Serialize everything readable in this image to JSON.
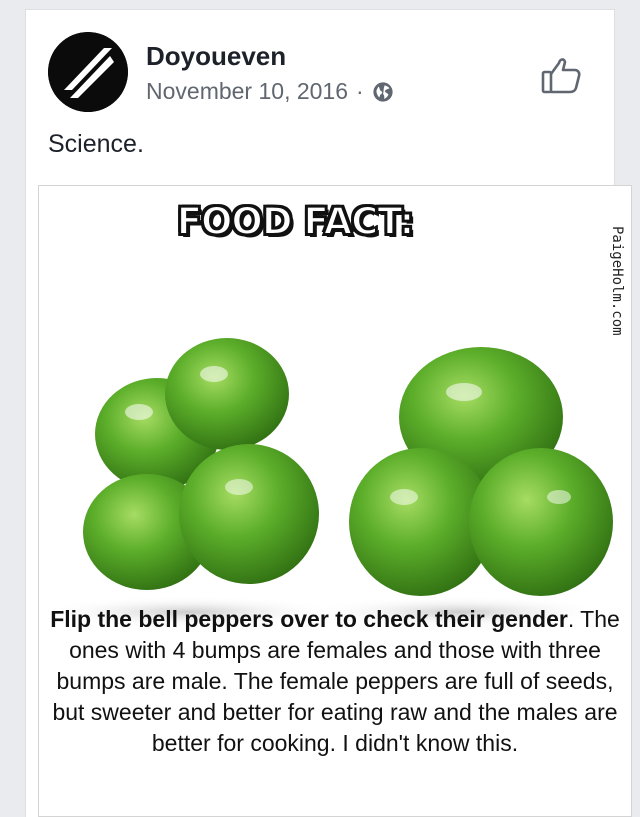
{
  "post": {
    "page_name": "Doyoueven",
    "date": "November 10, 2016",
    "separator": "·",
    "privacy_icon": "globe-icon",
    "like_icon": "thumbs-up-icon",
    "caption": "Science."
  },
  "image": {
    "headline": "FOOD FACT:",
    "watermark": "PaigeHolm.com",
    "fact_bold": "Flip the bell peppers over to check their gender",
    "fact_rest": ". The ones with 4 bumps are females and those with three bumps are male.  The female peppers are full of seeds, but sweeter and better for eating raw and the males are better for cooking.  I didn't know this."
  },
  "colors": {
    "pepper_green": "#5cae2a",
    "pepper_dark": "#2f6e12",
    "text_primary": "#1d2129",
    "text_secondary": "#616770"
  }
}
